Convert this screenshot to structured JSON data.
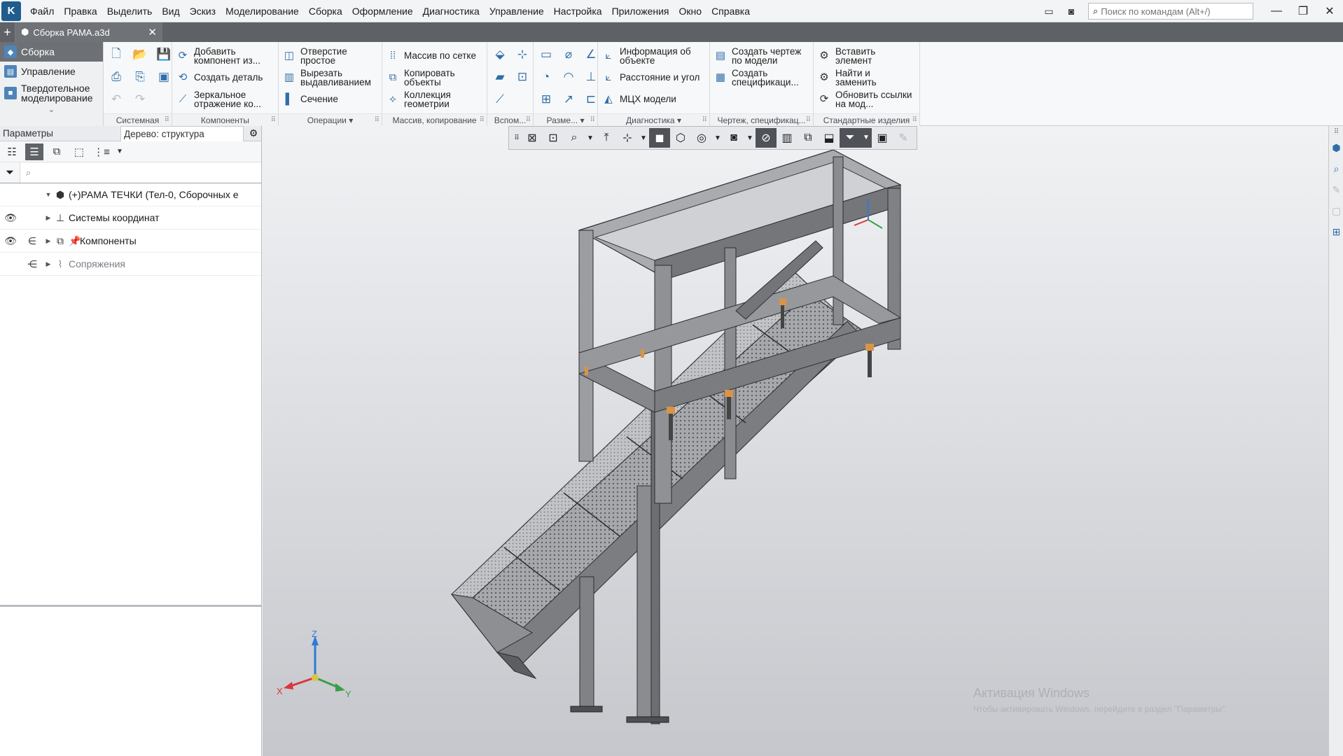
{
  "menu": {
    "items": [
      "Файл",
      "Правка",
      "Выделить",
      "Вид",
      "Эскиз",
      "Моделирование",
      "Сборка",
      "Оформление",
      "Диагностика",
      "Управление",
      "Настройка",
      "Приложения",
      "Окно",
      "Справка"
    ],
    "search_placeholder": "Поиск по командам (Alt+/)"
  },
  "document_tab": {
    "title": "Сборка РАМА.a3d"
  },
  "ribbon": {
    "modes": [
      "Сборка",
      "Управление",
      "Твердотельное моделирование"
    ],
    "groups": {
      "system": {
        "label": "Системная"
      },
      "components": {
        "label": "Компоненты",
        "buttons": [
          "Добавить компонент из...",
          "Создать деталь",
          "Зеркальное отражение ко..."
        ]
      },
      "operations": {
        "label": "Операции",
        "buttons": [
          "Отверстие простое",
          "Вырезать выдавливанием",
          "Сечение"
        ]
      },
      "arrays": {
        "label": "Массив, копирование",
        "buttons": [
          "Массив по сетке",
          "Копировать объекты",
          "Коллекция геометрии"
        ]
      },
      "auxiliary": {
        "label": "Вспом..."
      },
      "dimensions": {
        "label": "Разме..."
      },
      "diagnostics": {
        "label": "Диагностика",
        "buttons": [
          "Информация об объекте",
          "Расстояние и угол",
          "МЦХ модели"
        ]
      },
      "drawing": {
        "label": "Чертеж, спецификац...",
        "buttons": [
          "Создать чертеж по модели",
          "Создать спецификаци..."
        ]
      },
      "standard": {
        "label": "Стандартные изделия",
        "buttons": [
          "Вставить элемент",
          "Найти и заменить",
          "Обновить ссылки на мод..."
        ]
      }
    }
  },
  "left_panel": {
    "tabs": [
      "Параметры",
      "Дерево: структура"
    ],
    "filter_placeholder": "",
    "tree": [
      {
        "label": "РАМА ТЕЧКИ (Тел-0, Сборочных е",
        "prefix": "(+)"
      },
      {
        "label": "Системы координат"
      },
      {
        "label": "Компоненты"
      },
      {
        "label": "Сопряжения"
      }
    ]
  },
  "viewport": {
    "triad": {
      "x": "X",
      "y": "Y",
      "z": "Z"
    },
    "watermark": "Активация Windows",
    "watermark_sub": "Чтобы активировать Windows, перейдите в раздел \"Параметры\"."
  },
  "colors": {
    "accent": "#2f6ea8",
    "active_mode": "#6d7176",
    "tab_bar": "#5e6166",
    "axis_x": "#d9363e",
    "axis_y": "#3aa047",
    "axis_z": "#2f7bd6",
    "steel": "#8e9196"
  }
}
